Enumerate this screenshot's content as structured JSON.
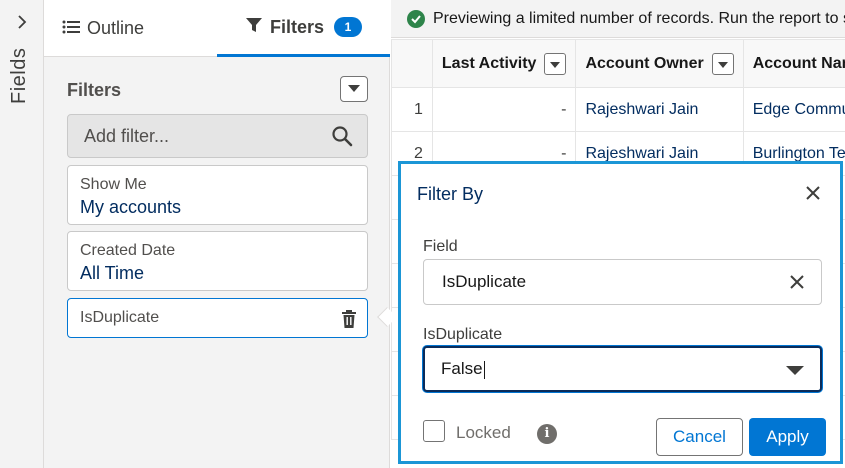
{
  "rail": {
    "label": "Fields"
  },
  "tabs": {
    "outline_label": "Outline",
    "filters_label": "Filters",
    "filters_count": "1"
  },
  "filters_panel": {
    "heading": "Filters",
    "add_filter_placeholder": "Add filter...",
    "cards": [
      {
        "label": "Show Me",
        "value": "My accounts"
      },
      {
        "label": "Created Date",
        "value": "All Time"
      },
      {
        "label": "IsDuplicate"
      }
    ]
  },
  "preview": {
    "banner": "Previewing a limited number of records. Run the report to see everything.",
    "columns": [
      "Last Activity",
      "Account Owner",
      "Account Name"
    ],
    "rows": [
      {
        "num": "1",
        "last_activity": "-",
        "owner": "Rajeshwari Jain",
        "account": "Edge Communications"
      },
      {
        "num": "2",
        "last_activity": "-",
        "owner": "Rajeshwari Jain",
        "account": "Burlington Textiles"
      }
    ]
  },
  "popover": {
    "title": "Filter By",
    "field_label": "Field",
    "field_value": "IsDuplicate",
    "select_label": "IsDuplicate",
    "select_value": "False",
    "locked_label": "Locked",
    "info_glyph": "i",
    "cancel_label": "Cancel",
    "apply_label": "Apply"
  },
  "colors": {
    "brand": "#0176d3",
    "popover_border": "#1b96d6",
    "success": "#2e844a"
  }
}
